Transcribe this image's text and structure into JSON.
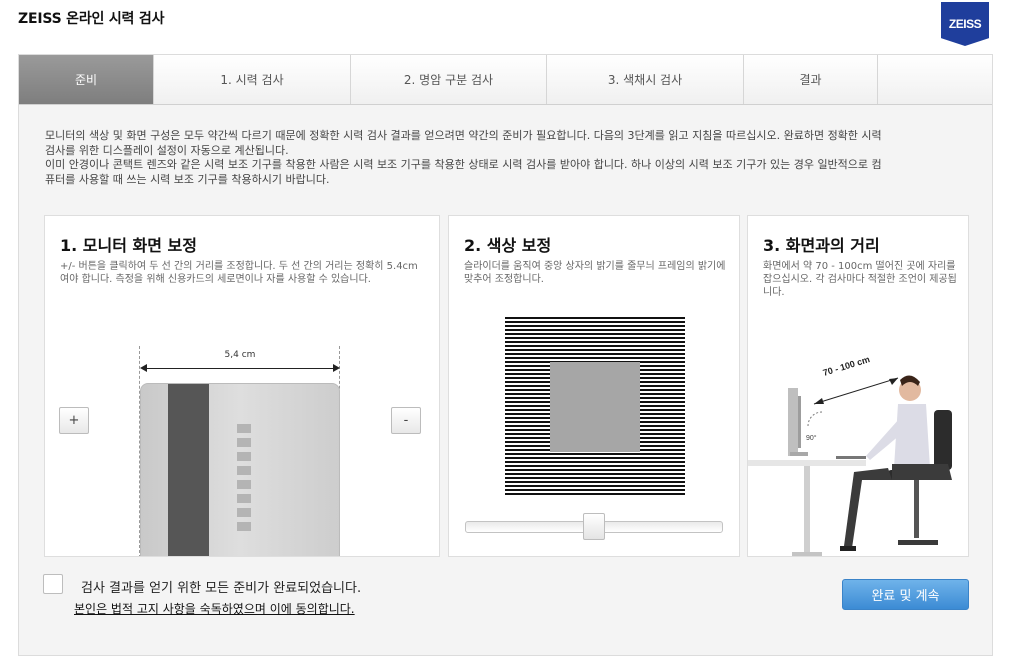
{
  "app": {
    "title": "ZEISS 온라인 시력 검사",
    "logo_text": "ZEISS",
    "brand_color": "#1f3e9c"
  },
  "tabs": [
    {
      "label": "준비",
      "active": true
    },
    {
      "label": "1. 시력 검사",
      "active": false
    },
    {
      "label": "2. 명암 구분 검사",
      "active": false
    },
    {
      "label": "3. 색채시 검사",
      "active": false
    },
    {
      "label": "결과",
      "active": false
    }
  ],
  "intro": {
    "line1": "모니터의 색상 및 화면 구성은 모두 약간씩 다르기 때문에 정확한 시력 검사 결과를 얻으려면 약간의 준비가 필요합니다. 다음의 3단계를 읽고 지침을 따르십시오. 완료하면 정확한 시력 검사를 위한 디스플레이 설정이 자동으로 계산됩니다.",
    "line2": "이미 안경이나 콘택트 렌즈와 같은 시력 보조 기구를 착용한 사람은 시력 보조 기구를 착용한 상태로 시력 검사를 받아야 합니다. 하나 이상의 시력 보조 기구가 있는 경우 일반적으로 컴퓨터를 사용할 때 쓰는 시력 보조 기구를 착용하시기 바랍니다."
  },
  "steps": {
    "monitor": {
      "title": "1. 모니터 화면 보정",
      "desc": "+/- 버튼을 클릭하여 두 선 간의 거리를 조정합니다. 두 선 간의 거리는 정확히 5.4cm여야 합니다. 측정을 위해 신용카드의 세로면이나 자를 사용할 수 있습니다.",
      "measure_label": "5,4 cm",
      "plus_label": "+",
      "minus_label": "-"
    },
    "color": {
      "title": "2. 색상 보정",
      "desc": "슬라이더를 움직여 중앙 상자의 밝기를 줄무늬 프레임의 밝기에 맞추어 조정합니다.",
      "slider_value_percent": 50
    },
    "distance": {
      "title": "3. 화면과의 거리",
      "desc": "화면에서 약 70 - 100cm 떨어진 곳에 자리를 잡으십시오. 각 검사마다 적절한 조언이 제공됩니다.",
      "distance_label": "70 - 100 cm",
      "angle_label": "90°"
    }
  },
  "footer": {
    "confirm_text": "검사 결과를 얻기 위한 모든 준비가 완료되었습니다.",
    "legal_link": "본인은 법적 고지 사항을 숙독하였으며 이에 동의합니다.",
    "continue_label": "완료 및 계속",
    "checkbox_checked": false
  }
}
